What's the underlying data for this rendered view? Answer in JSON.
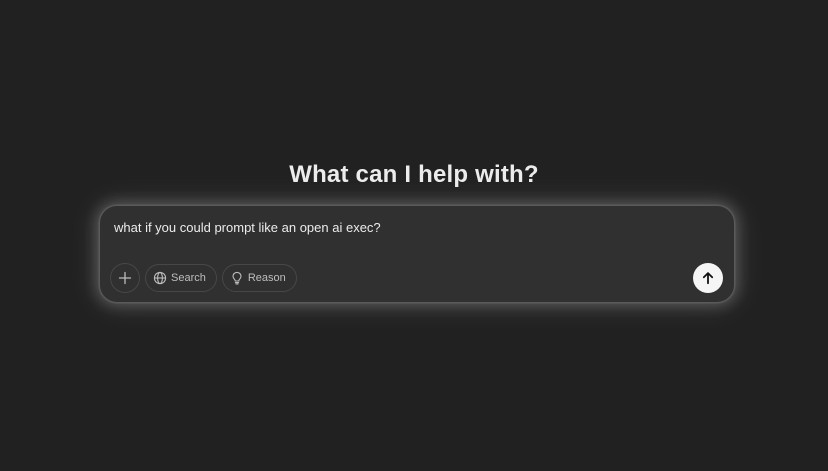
{
  "heading": "What can I help with?",
  "composer": {
    "value": "what if you could prompt like an open ai exec?",
    "add_icon": "plus-icon",
    "search_label": "Search",
    "search_icon": "globe-icon",
    "reason_label": "Reason",
    "reason_icon": "lightbulb-icon",
    "send_icon": "arrow-up-icon"
  },
  "colors": {
    "background": "#212121",
    "composer_background": "#303030",
    "send_button": "#f5f5f5"
  }
}
